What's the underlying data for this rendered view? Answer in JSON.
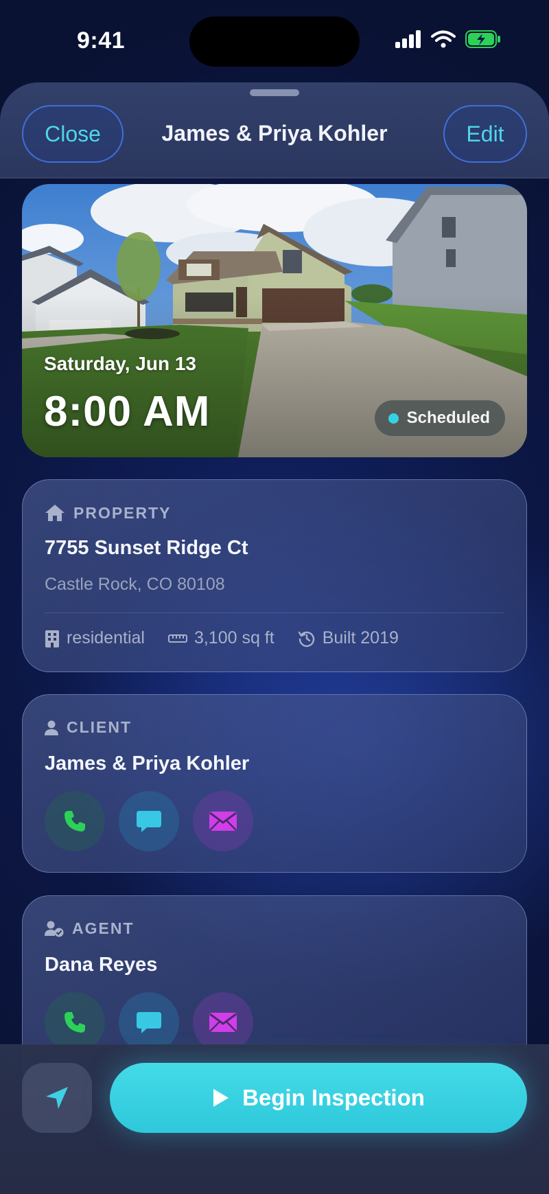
{
  "status_bar": {
    "time": "9:41"
  },
  "header": {
    "close_label": "Close",
    "title": "James & Priya Kohler",
    "edit_label": "Edit"
  },
  "hero": {
    "date": "Saturday, Jun 13",
    "time": "8:00 AM",
    "status": "Scheduled"
  },
  "property": {
    "heading": "PROPERTY",
    "address": "7755 Sunset Ridge Ct",
    "city": "Castle Rock, CO 80108",
    "type": "residential",
    "size": "3,100 sq ft",
    "built": "Built 2019"
  },
  "client": {
    "heading": "CLIENT",
    "name": "James & Priya Kohler"
  },
  "agent": {
    "heading": "AGENT",
    "name": "Dana Reyes"
  },
  "footer": {
    "begin_label": "Begin Inspection"
  },
  "icons": {
    "home": "home-icon",
    "building": "building-icon",
    "ruler": "ruler-icon",
    "history": "history-icon",
    "person": "person-icon",
    "agent": "person-check-icon",
    "phone": "phone-icon",
    "message": "message-icon",
    "mail": "mail-icon",
    "navigate": "navigation-arrow-icon",
    "play": "play-icon"
  },
  "colors": {
    "accent": "#35d2e6",
    "call": "#2ed158",
    "message": "#38c8e4",
    "mail": "#d13ee8"
  }
}
